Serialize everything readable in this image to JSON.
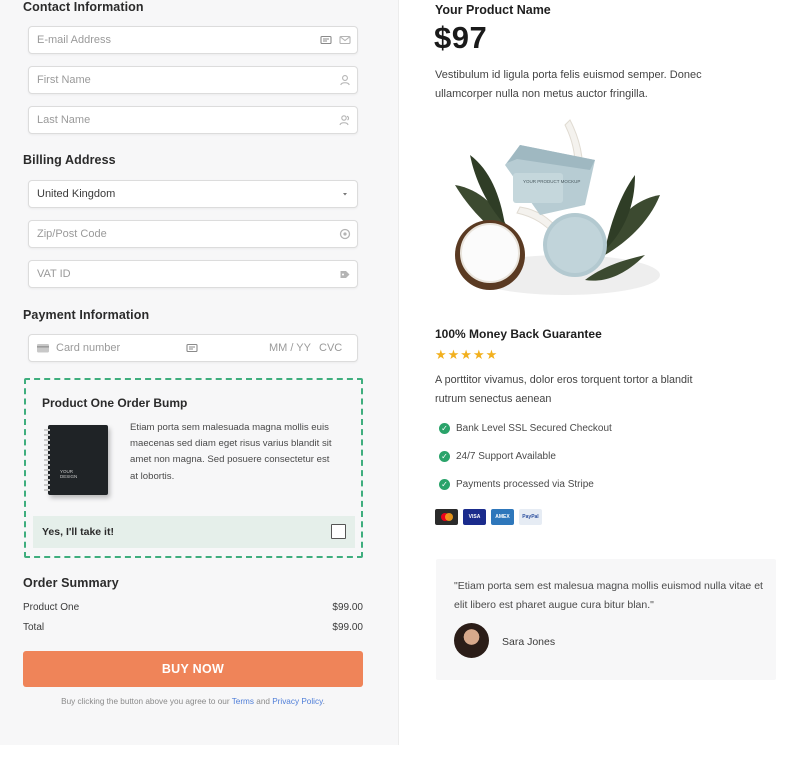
{
  "contact": {
    "title": "Contact Information",
    "email_placeholder": "E-mail Address",
    "first_name_placeholder": "First Name",
    "last_name_placeholder": "Last Name"
  },
  "billing": {
    "title": "Billing Address",
    "country_value": "United Kingdom",
    "zip_placeholder": "Zip/Post Code",
    "vat_placeholder": "VAT ID"
  },
  "payment": {
    "title": "Payment Information",
    "card_placeholder": "Card number",
    "expiry_placeholder": "MM / YY",
    "cvc_placeholder": "CVC"
  },
  "bump": {
    "title": "Product One Order Bump",
    "description": "Etiam porta sem malesuada magna mollis euis maecenas sed diam eget risus varius blandit sit amet non magna. Sed posuere consectetur est at lobortis.",
    "take_label": "Yes, I'll take it!",
    "notebook_label": "YOUR\nDESIGN"
  },
  "summary": {
    "title": "Order Summary",
    "rows": [
      {
        "label": "Product One",
        "amount": "$99.00"
      },
      {
        "label": "Total",
        "amount": "$99.00"
      }
    ]
  },
  "buy_button": "BUY NOW",
  "terms": {
    "prefix": "Buy clicking the button above you agree to our ",
    "terms_link": "Terms",
    "and": " and ",
    "privacy_link": "Privacy Policy",
    "suffix": "."
  },
  "product": {
    "name": "Your Product Name",
    "price": "$97",
    "description": "Vestibulum id ligula porta felis euismod semper. Donec ullamcorper nulla non metus auctor fringilla.",
    "jar_label": "YOUR PRODUCT MOCKUP"
  },
  "guarantee": {
    "title": "100% Money Back Guarantee",
    "stars": "★★★★★",
    "rating": 5,
    "description": "A porttitor vivamus, dolor eros torquent tortor a blandit rutrum senectus aenean",
    "features": [
      "Bank Level SSL Secured Checkout",
      "24/7 Support Available",
      "Payments processed via Stripe"
    ],
    "cards": [
      {
        "name": "mastercard",
        "label": "",
        "color": "#2b2b2b"
      },
      {
        "name": "visa",
        "label": "VISA",
        "color": "#1a2b8c"
      },
      {
        "name": "amex",
        "label": "AMEX",
        "color": "#2e77bb"
      },
      {
        "name": "paypal",
        "label": "PayPal",
        "color": "#e6ecf4"
      }
    ]
  },
  "testimonial": {
    "quote": "\"Etiam porta sem est malesua magna mollis euismod nulla vitae et elit libero est pharet augue cura bitur blan.\"",
    "author": "Sara Jones"
  },
  "colors": {
    "accent": "#ef8459",
    "bump_border": "#3fae7e",
    "check": "#2aa36a",
    "star": "#f2b01e",
    "link": "#4f7ed8"
  }
}
